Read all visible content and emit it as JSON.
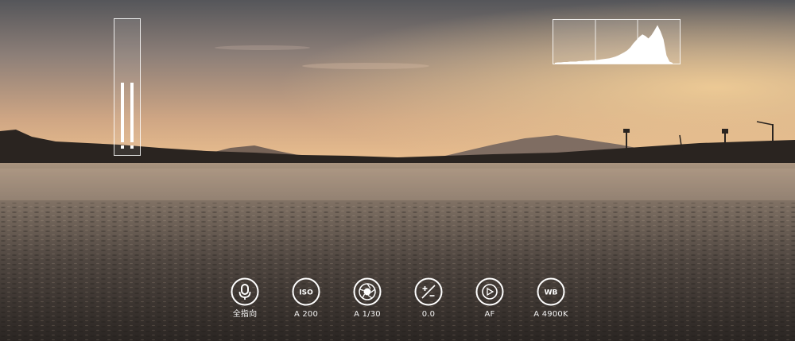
{
  "audio_meter": {
    "levels": [
      0.52,
      0.52
    ]
  },
  "histogram": {
    "bins": [
      0.02,
      0.03,
      0.03,
      0.04,
      0.04,
      0.05,
      0.05,
      0.05,
      0.06,
      0.06,
      0.07,
      0.07,
      0.08,
      0.08,
      0.09,
      0.1,
      0.11,
      0.12,
      0.13,
      0.15,
      0.17,
      0.2,
      0.24,
      0.28,
      0.33,
      0.4,
      0.5,
      0.58,
      0.66,
      0.72,
      0.68,
      0.62,
      0.7,
      0.82,
      0.95,
      0.8,
      0.6,
      0.2,
      0.05,
      0.02
    ]
  },
  "controls": [
    {
      "id": "audio",
      "icon": "microphone-icon",
      "label": "全指向"
    },
    {
      "id": "iso",
      "icon": "iso-icon",
      "icon_text": "ISO",
      "label": "A 200"
    },
    {
      "id": "shutter",
      "icon": "aperture-icon",
      "label": "A 1/30"
    },
    {
      "id": "ev",
      "icon": "exposure-icon",
      "label": "0.0"
    },
    {
      "id": "focus",
      "icon": "focus-icon",
      "label": "AF"
    },
    {
      "id": "wb",
      "icon": "white-balance-icon",
      "icon_text": "WB",
      "label": "A 4900K"
    }
  ],
  "colors": {
    "ui": "#ffffff",
    "sky_top": "#5b5a5c",
    "sky_horizon": "#e6b98b"
  }
}
